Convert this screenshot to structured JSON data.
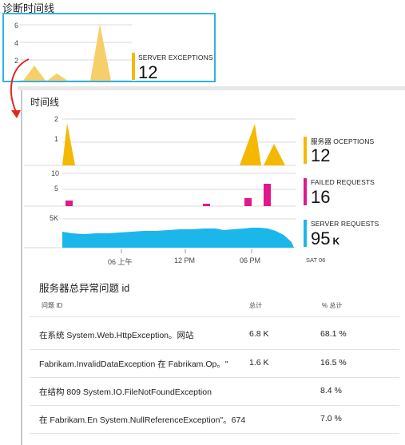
{
  "top_tile": {
    "title": "诊断时间线",
    "y_ticks": [
      "6",
      "4",
      "2"
    ],
    "metric_label": "SERVER EXCEPTIONS",
    "metric_value": "12",
    "accent": "#f5b800"
  },
  "panel": {
    "title": "时间线",
    "charts": [
      {
        "y_ticks": [
          "2",
          "1"
        ],
        "metric_label": "服务器 OCEPTIONS",
        "metric_value": "12",
        "color": "#f5b800",
        "values": [
          2,
          0,
          0,
          0,
          0,
          0,
          0,
          0,
          0,
          2,
          1
        ]
      },
      {
        "y_ticks": [
          "10",
          "5"
        ],
        "metric_label": "FAILED REQUESTS",
        "metric_value": "16",
        "color": "#e0188c",
        "values": [
          2,
          0,
          0,
          0,
          1,
          0,
          0,
          3,
          7
        ]
      },
      {
        "y_ticks": [
          "5K"
        ],
        "metric_label": "SERVER REQUESTS",
        "metric_value": "95",
        "metric_unit": "K",
        "color": "#1cb7ea"
      }
    ],
    "x_ticks": [
      "06 上午",
      "12 PM",
      "06 PM",
      "SAT 06"
    ]
  },
  "table": {
    "title": "服务器总异常问题 id",
    "headers": [
      "问题 ID",
      "总计",
      "% 总计"
    ],
    "rows": [
      {
        "id": "在系统 System.Web.HttpException。网站",
        "count": "6.8 K",
        "pct": "68.1 %"
      },
      {
        "id": "Fabrikam.InvalidDataException 在 Fabrikam.Op。\"",
        "count": "1.6 K",
        "pct": "16.5 %"
      },
      {
        "id": "在结构 809 System.IO.FileNotFoundException",
        "count": "",
        "pct": "8.4 %"
      },
      {
        "id": "在 Fabrikam.En System.NullReferenceException\"。674",
        "count": "",
        "pct": "7.0 %"
      }
    ]
  },
  "colors": {
    "highlight_border": "#2fb3e6",
    "arrow": "#e0281e"
  }
}
